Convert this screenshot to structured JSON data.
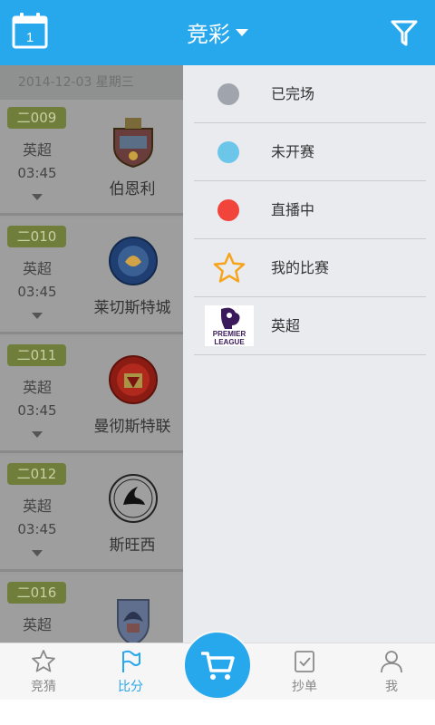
{
  "header": {
    "calendar_day": "1",
    "title": "竞彩"
  },
  "list": {
    "date": "2014-12-03 星期三",
    "matches": [
      {
        "code": "二009",
        "league": "英超",
        "time": "03:45",
        "team": "伯恩利",
        "crest": "burnley-crest-icon"
      },
      {
        "code": "二010",
        "league": "英超",
        "time": "03:45",
        "team": "莱切斯特城",
        "crest": "leicester-crest-icon"
      },
      {
        "code": "二011",
        "league": "英超",
        "time": "03:45",
        "team": "曼彻斯特联",
        "crest": "man-united-crest-icon"
      },
      {
        "code": "二012",
        "league": "英超",
        "time": "03:45",
        "team": "斯旺西",
        "crest": "swansea-crest-icon"
      },
      {
        "code": "二016",
        "league": "英超",
        "time": "",
        "team": "",
        "crest": "crystal-palace-crest-icon"
      }
    ]
  },
  "filter_panel": {
    "items": [
      {
        "label": "已完场",
        "icon": "finished-dot-icon",
        "color": "#a0a4ad"
      },
      {
        "label": "未开赛",
        "icon": "not-started-dot-icon",
        "color": "#6cc6ea"
      },
      {
        "label": "直播中",
        "icon": "live-dot-icon",
        "color": "#f1443b"
      },
      {
        "label": "我的比赛",
        "icon": "star-icon",
        "color": "#f7a41d"
      },
      {
        "label": "英超",
        "icon": "premier-league-logo"
      }
    ],
    "premier_logo_text": [
      "PREMIER",
      "LEAGUE"
    ]
  },
  "tabbar": {
    "tabs": [
      {
        "label": "竞猜",
        "icon": "star-outline-icon"
      },
      {
        "label": "比分",
        "icon": "flag-icon",
        "active": true
      },
      {
        "label": "抄单",
        "icon": "checklist-icon"
      },
      {
        "label": "我",
        "icon": "user-icon"
      }
    ],
    "cart_icon": "cart-icon"
  },
  "colors": {
    "accent": "#27a7ec",
    "badge": "#6f7e3b"
  }
}
